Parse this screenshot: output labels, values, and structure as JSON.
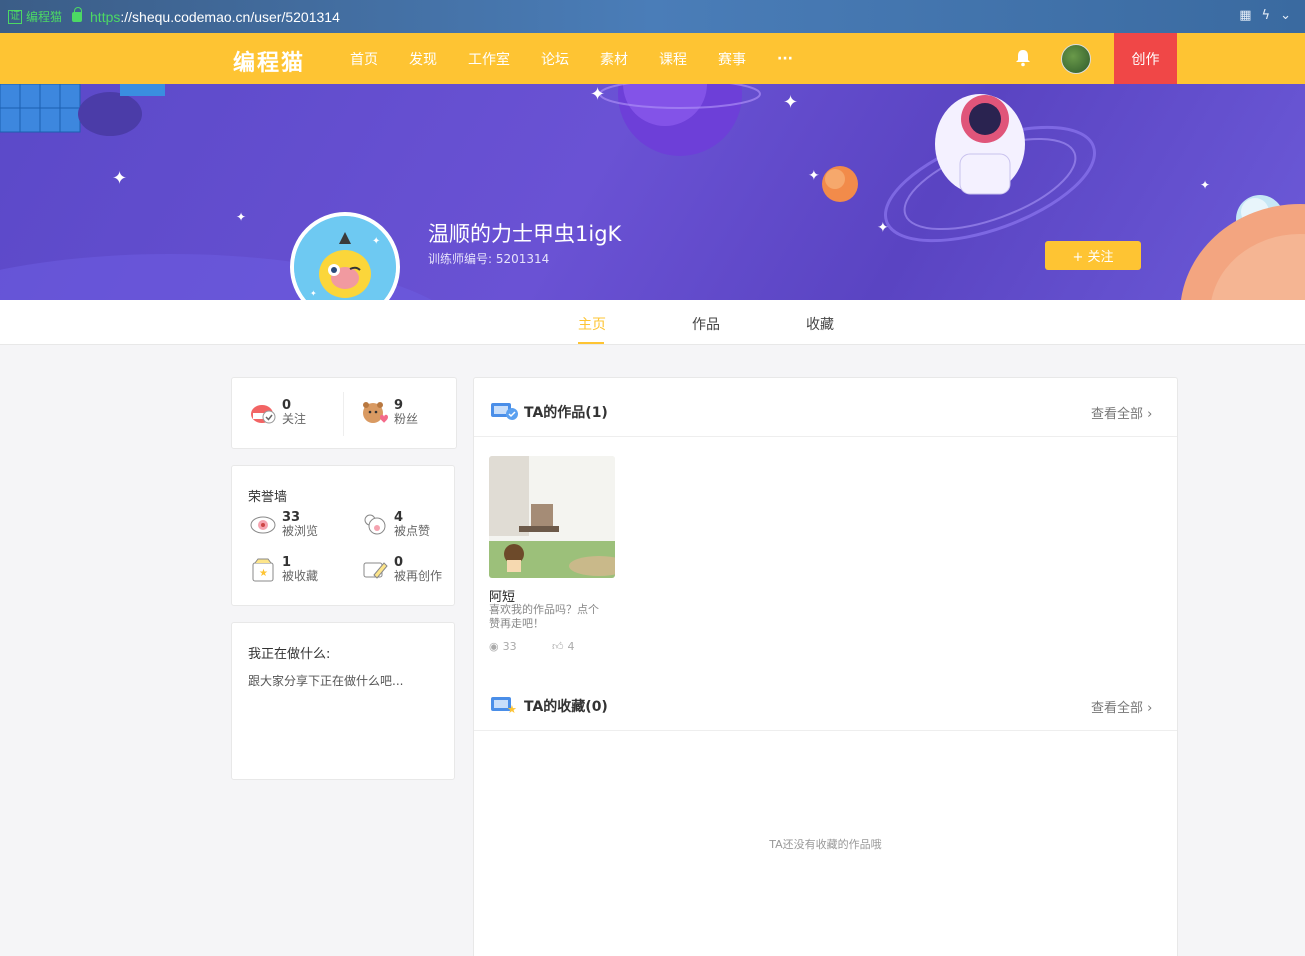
{
  "browser": {
    "cert_label": "编程猫",
    "cert_box": "证",
    "url_proto": "https",
    "url_rest": "://shequ.codemao.cn/user/5201314"
  },
  "nav": {
    "logo": "编程猫",
    "items": [
      "首页",
      "发现",
      "工作室",
      "论坛",
      "素材",
      "课程",
      "赛事",
      "···"
    ],
    "create": "创作"
  },
  "profile": {
    "name": "温顺的力士甲虫1igK",
    "id_text": "训练师编号: 5201314",
    "follow_btn": "+ 关注"
  },
  "tabs": [
    "主页",
    "作品",
    "收藏"
  ],
  "social": {
    "following_count": "0",
    "following_label": "关注",
    "fans_count": "9",
    "fans_label": "粉丝"
  },
  "honor": {
    "title": "荣誉墙",
    "views_count": "33",
    "views_label": "被浏览",
    "likes_count": "4",
    "likes_label": "被点赞",
    "collects_count": "1",
    "collects_label": "被收藏",
    "remix_count": "0",
    "remix_label": "被再创作"
  },
  "doing": {
    "title": "我正在做什么:",
    "placeholder": "跟大家分享下正在做什么吧..."
  },
  "works": {
    "title": "TA的作品(1)",
    "see_all": "查看全部",
    "item": {
      "name": "阿短",
      "desc_line1": "喜欢我的作品吗？点个",
      "desc_line2": "赞再走吧！",
      "views": "33",
      "likes": "4"
    }
  },
  "favorites": {
    "title": "TA的收藏(0)",
    "see_all": "查看全部",
    "empty": "TA还没有收藏的作品哦"
  },
  "colors": {
    "brand": "#fec433",
    "create": "#f04747",
    "banner": "#5b49c8"
  }
}
